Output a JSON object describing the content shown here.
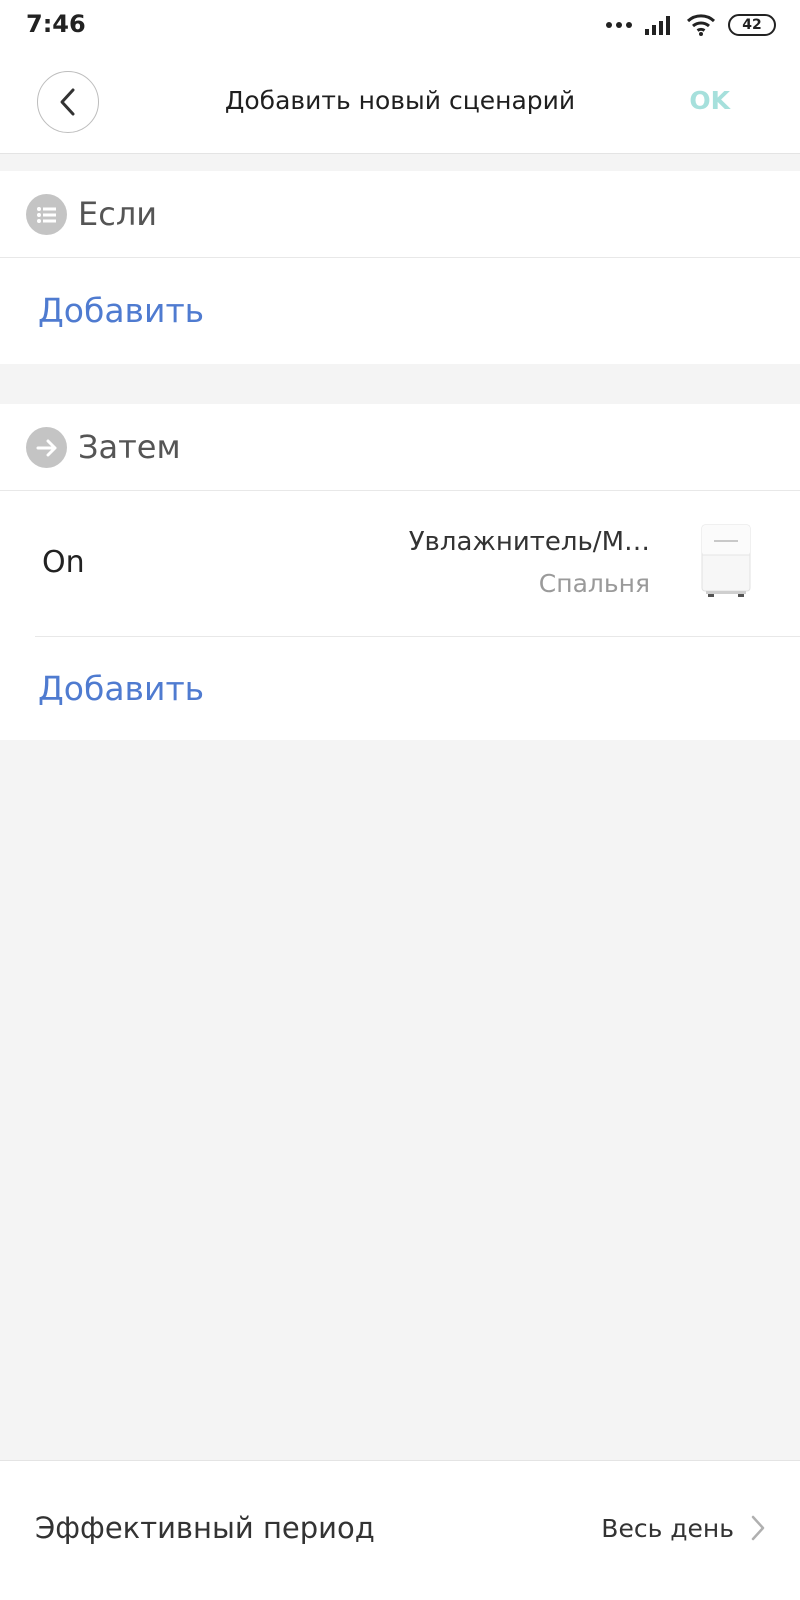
{
  "status_bar": {
    "time": "7:46",
    "battery": "42",
    "icons": [
      "dots-icon",
      "signal-icon",
      "wifi-icon",
      "battery-icon"
    ]
  },
  "header": {
    "title": "Добавить новый сценарий",
    "ok_label": "OK",
    "back_icon": "chevron-left-icon"
  },
  "if_section": {
    "label": "Если",
    "icon": "list-icon",
    "add_label": "Добавить"
  },
  "then_section": {
    "label": "Затем",
    "icon": "arrow-right-icon",
    "actions": [
      {
        "name": "On",
        "device": "Увлажнитель/M…",
        "room": "Спальня",
        "thumbnail": "humidifier-image"
      }
    ],
    "add_label": "Добавить"
  },
  "effective_period": {
    "label": "Эффективный период",
    "value": "Весь день",
    "icon": "chevron-right-icon"
  },
  "colors": {
    "accent_link": "#4f7bd0",
    "ok_disabled": "#a6e0dc",
    "background": "#f4f4f4",
    "card": "#ffffff",
    "icon_circle": "#c4c4c4"
  }
}
